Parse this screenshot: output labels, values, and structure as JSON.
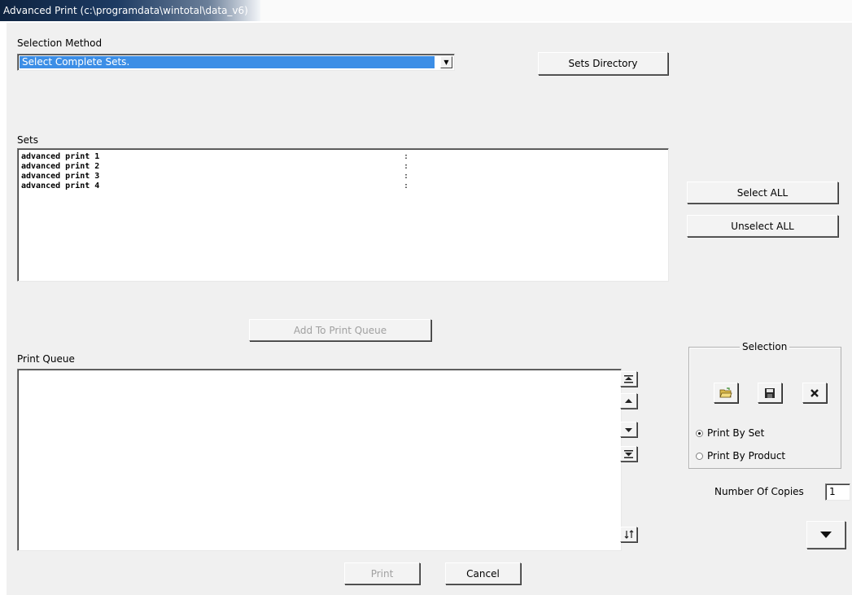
{
  "window": {
    "title": "Advanced Print (c:\\programdata\\wintotal\\data_v6)"
  },
  "selection_method": {
    "label": "Selection Method",
    "selected": "Select Complete Sets."
  },
  "buttons": {
    "sets_directory": "Sets Directory",
    "select_all": "Select ALL",
    "unselect_all": "Unselect ALL",
    "add_to_print_queue": "Add To Print Queue",
    "print": "Print",
    "cancel": "Cancel"
  },
  "sets": {
    "label": "Sets",
    "items": [
      {
        "name": "advanced print 1",
        "sep": ":"
      },
      {
        "name": "advanced print 2",
        "sep": ":"
      },
      {
        "name": "advanced print 3",
        "sep": ":"
      },
      {
        "name": "advanced print 4",
        "sep": ":"
      }
    ]
  },
  "print_queue": {
    "label": "Print Queue"
  },
  "selection_group": {
    "legend": "Selection",
    "radio_print_by_set": "Print By Set",
    "radio_print_by_product": "Print By Product",
    "selected_option": "Print By Set"
  },
  "copies": {
    "label": "Number Of Copies",
    "value": "1"
  },
  "icons": {
    "move_top": "move-top-icon",
    "move_up": "move-up-icon",
    "move_down": "move-down-icon",
    "move_bottom": "move-bottom-icon",
    "sort": "sort-icon",
    "open": "open-folder-icon",
    "save": "save-icon",
    "delete": "delete-icon",
    "more": "dropdown-arrow-icon"
  }
}
